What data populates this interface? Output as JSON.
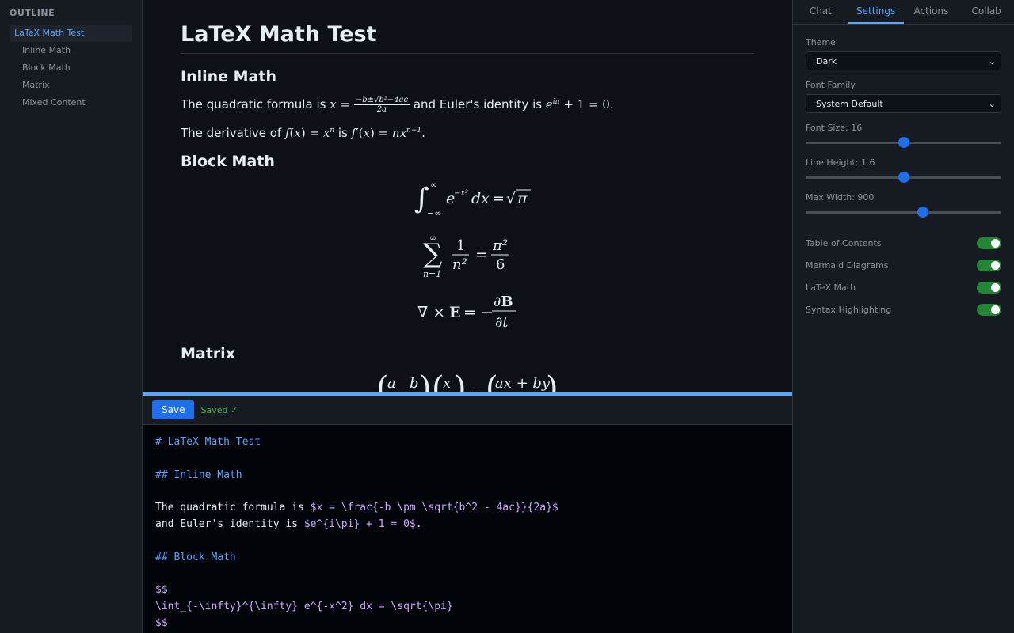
{
  "outline": {
    "title": "OUTLINE",
    "items": [
      {
        "label": "LaTeX Math Test"
      },
      {
        "label": "Inline Math"
      },
      {
        "label": "Block Math"
      },
      {
        "label": "Matrix"
      },
      {
        "label": "Mixed Content"
      }
    ]
  },
  "preview": {
    "h1": "LaTeX Math Test",
    "h2_inline": "Inline Math",
    "p1_a": "The quadratic formula is",
    "p1_b": "and Euler's identity is",
    "p2_a": "The derivative of",
    "p2_b": "is",
    "h2_block": "Block Math",
    "h2_matrix": "Matrix"
  },
  "toolbar": {
    "save_label": "Save",
    "status": "Saved ✓"
  },
  "editor": {
    "lines": [
      "# LaTeX Math Test",
      "",
      "## Inline Math",
      "",
      "The quadratic formula is $x = \\frac{-b \\pm \\sqrt{b^2 - 4ac}}{2a}$",
      "and Euler's identity is $e^{i\\pi} + 1 = 0$.",
      "",
      "## Block Math",
      "",
      "$$",
      "\\int_{-\\infty}^{\\infty} e^{-x^2} dx = \\sqrt{\\pi}",
      "$$"
    ]
  },
  "right": {
    "tabs": [
      "Chat",
      "Settings",
      "Actions",
      "Collab"
    ],
    "active_tab": "Settings",
    "theme_label": "Theme",
    "theme_value": "Dark",
    "font_family_label": "Font Family",
    "font_family_value": "System Default",
    "font_size_label": "Font Size: 16",
    "font_size_level": 0.5,
    "line_height_label": "Line Height: 1.6",
    "line_height_level": 0.5,
    "max_width_label": "Max Width: 900",
    "max_width_level": 0.6,
    "toggles": [
      {
        "label": "Table of Contents",
        "on": true
      },
      {
        "label": "Mermaid Diagrams",
        "on": true
      },
      {
        "label": "LaTeX Math",
        "on": true
      },
      {
        "label": "Syntax Highlighting",
        "on": true
      }
    ]
  },
  "colors": {
    "accent": "#58a6ff",
    "toggle_on": "#238636",
    "saved": "#3fb950"
  }
}
